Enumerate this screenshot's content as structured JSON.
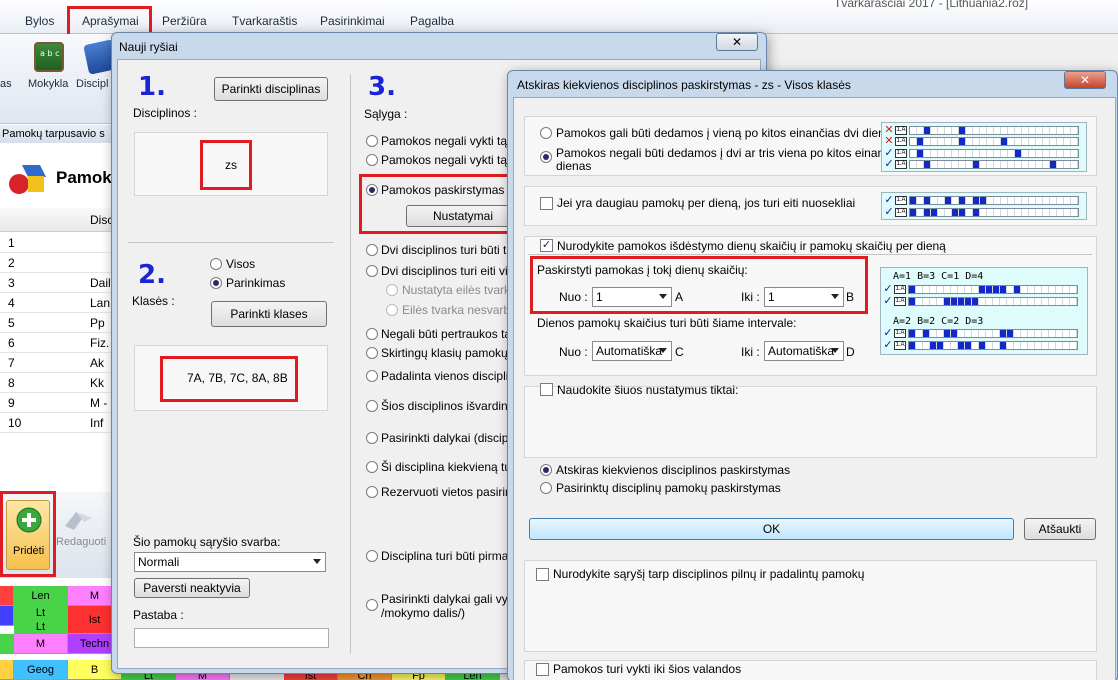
{
  "app": {
    "title": "Tvarkaraščiai 2017 - [Lithuania2.roz]",
    "menu": [
      "Bylos",
      "Aprašymai",
      "Peržiūra",
      "Tvarkaraštis",
      "Pasirinkimai",
      "Pagalba"
    ],
    "ribbon": {
      "cut_left": "as",
      "school": "Mokykla",
      "subjects_cut": "Discipl"
    },
    "left_panel": {
      "caption": "Pamokų tarpusavio s",
      "heading": "Pamok",
      "column_header": "Disc",
      "rows": [
        {
          "n": "1",
          "d": ""
        },
        {
          "n": "2",
          "d": ""
        },
        {
          "n": "3",
          "d": "Dail"
        },
        {
          "n": "4",
          "d": "Lan"
        },
        {
          "n": "5",
          "d": "Pp"
        },
        {
          "n": "6",
          "d": "Fiz."
        },
        {
          "n": "7",
          "d": "Ak"
        },
        {
          "n": "8",
          "d": "Kk"
        },
        {
          "n": "9",
          "d": "M -"
        },
        {
          "n": "10",
          "d": "Inf"
        }
      ],
      "add_button": "Pridėti",
      "edit_button": "Redaguoti"
    },
    "bottom_cells": [
      "Len",
      "M",
      "Lt",
      "Lt",
      "Ist",
      "M",
      "Techn",
      "Geog",
      "B",
      "Lt",
      "M",
      "Ist",
      "Ch",
      "Fp",
      "Len"
    ]
  },
  "dlg1": {
    "title": "Nauji ryšiai",
    "num1": "1.",
    "num2": "2.",
    "num3": "3.",
    "pick_subjects_btn": "Parinkti disciplinas",
    "subjects_label": "Disciplinos :",
    "subjects_value": "zs",
    "classes_all": "Visos",
    "classes_selection": "Parinkimas",
    "classes_label": "Klasės :",
    "pick_classes_btn": "Parinkti klases",
    "classes_value": "7A, 7B, 7C, 8A, 8B",
    "importance_label": "Šio pamokų sąryšio svarba:",
    "importance_value": "Normali",
    "make_inactive_btn": "Paversti neaktyvia",
    "note_label": "Pastaba :",
    "condition_label": "Sąlyga :",
    "conditions": [
      "Pamokos negali vykti tą pa",
      "Pamokos negali vykti tą pa",
      "Pamokos paskirstymas per",
      "Dvi disciplinos turi būti ta",
      "Dvi disciplinos turi eiti viena",
      "Nustatyta eilės tvarka",
      "Eilės tvarka nesvarb",
      "Negali būti pertraukos tarp",
      "Skirtingų klasių pamokų gru",
      "Padalinta vienos disciplinos",
      "Šios disciplinos išvardintoms",
      "Pasirinkti dalykai (disciplino",
      "Ši disciplina kiekvieną turi v",
      "Rezervuoti vietos pasirinkti",
      "Disciplina turi būti pirma ar",
      "Pasirinkti dalykai gali vykti p",
      "/mokymo dalis/)"
    ],
    "settings_btn": "Nustatymai"
  },
  "dlg2": {
    "title": "Atskiras kiekvienos disciplinos paskirstymas - zs - Visos klasės",
    "opt_two_days": "Pamokos gali būti dedamos į vieną po kitos einančias dvi dienas",
    "opt_no_two_three_line1": "Pamokos negali būti dedamos į dvi ar tris viena po kitos einančias",
    "opt_no_two_three_line2": "dienas",
    "opt_consecutive": "Jei yra daugiau pamokų per dieną, jos turi eiti nuosekliai",
    "opt_specify_days": "Nurodykite pamokos išdėstymo dienų skaičių ir pamokų skaičių per dieną",
    "distribute_label": "Paskirstyti pamokas į tokį dienų skaičių:",
    "from_label": "Nuo :",
    "from_value": "1",
    "from_suffix": "A",
    "to_label": "Iki :",
    "to_value": "1",
    "to_suffix": "B",
    "interval_label": "Dienos pamokų skaičius turi būti šiame intervale:",
    "from2_value": "Automatiška",
    "from2_suffix": "C",
    "to2_value": "Automatiška",
    "to2_suffix": "D",
    "legend1": "A=1 B=3 C=1 D=4",
    "legend2": "A=2 B=2 C=2 D=3",
    "use_only_label": "Naudokite šiuos nustatymus tiktai:",
    "mode_separate": "Atskiras kiekvienos disciplinos paskirstymas",
    "mode_selected": "Pasirinktų disciplinų pamokų paskirstymas",
    "ok_btn": "OK",
    "cancel_btn": "Atšaukti",
    "relation_label": "Nurodykite sąryšį tarp disciplinos pilnų ir padalintų pamokų",
    "until_label": "Pamokos turi vykti iki šios valandos",
    "icon_label": "1.A"
  },
  "colors": {
    "highlight": "#e01b22",
    "number_blue": "#1a24d6",
    "pattern_fill": "#1428c8"
  }
}
